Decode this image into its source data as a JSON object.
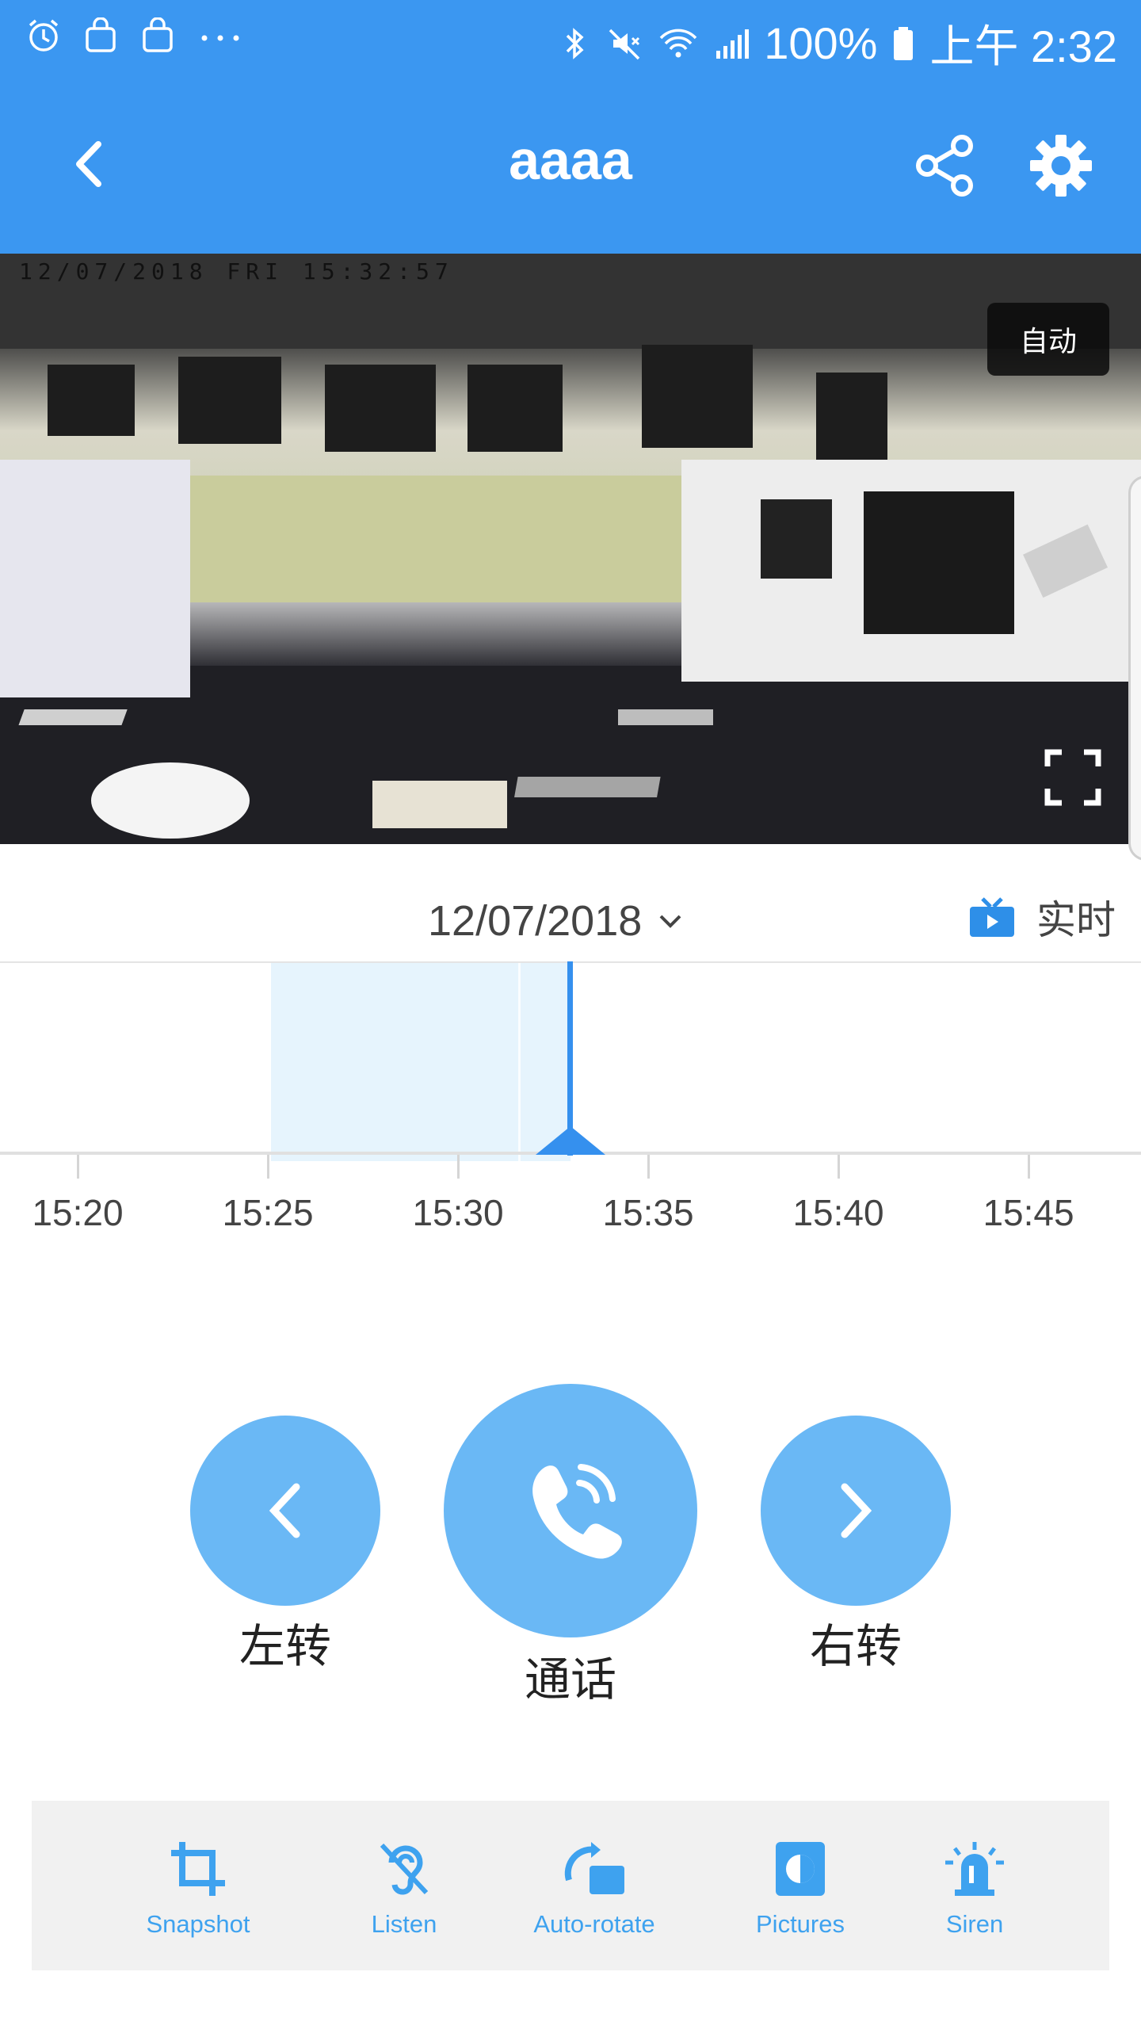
{
  "status_bar": {
    "battery": "100%",
    "time": "上午 2:32",
    "left_icons": [
      "alarm-icon",
      "bag-icon",
      "bag-icon",
      "more-icon"
    ],
    "right_icons": [
      "bluetooth-icon",
      "mute-icon",
      "wifi-icon",
      "signal-icon",
      "battery-icon"
    ]
  },
  "header": {
    "title": "aaaa",
    "back_icon": "chevron-left-icon",
    "share_icon": "share-icon",
    "settings_icon": "gear-icon",
    "color": "#3b97f1"
  },
  "video": {
    "timestamp": "12/07/2018 FRI 15:32:57",
    "mode_badge": "自动",
    "fullscreen_icon": "fullscreen-icon"
  },
  "playback": {
    "date": "12/07/2018",
    "live_label": "实时",
    "live_icon": "tv-icon"
  },
  "timeline": {
    "ticks": [
      "15:20",
      "15:25",
      "15:30",
      "15:35",
      "15:40",
      "15:45"
    ],
    "recorded_start": "15:25",
    "recorded_end": "15:33",
    "cursor_time": "15:32:57"
  },
  "controls": {
    "left": {
      "label": "左转",
      "icon": "chevron-left-icon"
    },
    "talk": {
      "label": "通话",
      "icon": "phone-icon"
    },
    "right": {
      "label": "右转",
      "icon": "chevron-right-icon"
    },
    "button_color": "#6ab8f5"
  },
  "tools": [
    {
      "label": "Snapshot",
      "icon": "crop-icon"
    },
    {
      "label": "Listen",
      "icon": "ear-icon"
    },
    {
      "label": "Auto-rotate",
      "icon": "rotate-icon"
    },
    {
      "label": "Pictures",
      "icon": "pictures-icon"
    },
    {
      "label": "Siren",
      "icon": "siren-icon"
    }
  ],
  "accent_color": "#3ea2ef"
}
